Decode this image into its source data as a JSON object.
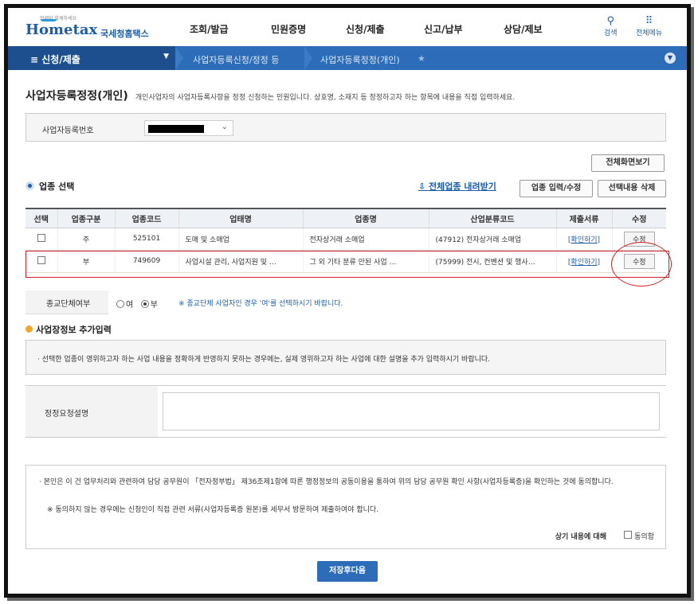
{
  "header": {
    "logo_tagline": "언제와 함께하세요",
    "logo_brand": "Hometax",
    "logo_kr": "국세청홈택스",
    "gnb": [
      "조회/발급",
      "민원증명",
      "신청/제출",
      "신고/납부",
      "상담/제보"
    ],
    "search_label": "검색",
    "all_menu_label": "전체메뉴"
  },
  "nav": {
    "menu_label": "≡  신청/제출",
    "breadcrumb": [
      "사업자등록신청/정정 등",
      "사업자등록정정(개인)"
    ]
  },
  "page": {
    "title": "사업자등록정정(개인)",
    "description": "개인사업자의 사업자등록사항을 정정 신청하는 민원입니다. 상호명, 소재지 등 정정하고자 하는 항목에 내용을 직접 입력하세요."
  },
  "biz": {
    "label": "사업자등록번호"
  },
  "buttons": {
    "full_view": "전체화면보기",
    "industry_edit": "업종 입력/수정",
    "delete_selected": "선택내용 삭제",
    "save_next": "저장후다음"
  },
  "industry": {
    "section_title": "업종 선택",
    "download_all": "전체업종 내려받기",
    "columns": [
      "선택",
      "업종구분",
      "업종코드",
      "업태명",
      "업종명",
      "산업분류코드",
      "제출서류",
      "수정"
    ],
    "rows": [
      {
        "type": "주",
        "code": "525101",
        "biz_type": "도매 및 소매업",
        "item": "전자상거래 소매업",
        "class_code": "(47912) 전자상거래 소매업",
        "doc": "[확인하기]",
        "edit": "수정"
      },
      {
        "type": "부",
        "code": "749609",
        "biz_type": "사업시설 관리, 사업지원 및 …",
        "item": "그 외 기타 분류 안된 사업 …",
        "class_code": "(75999) 전시, 컨벤션 및 행사…",
        "doc": "[확인하기]",
        "edit": "수정"
      }
    ]
  },
  "religion": {
    "label": "종교단체여부",
    "yes": "여",
    "no": "부",
    "selected": "부",
    "note": "※ 종교단체 사업자인 경우 '여'를 선택하시기 바랍니다."
  },
  "workplace": {
    "section_title": "사업장정보 추가입력",
    "info": "· 선택한 업종이 영위하고자 하는 사업 내용을 정확하게 반영하지 못하는 경우에는, 실제 영위하고자 하는 사업에 대한 설명을 추가 입력하시기 바랍니다.",
    "request_label": "정정요청설명"
  },
  "consent": {
    "p1": "· 본인은 이 건 업무처리와 관련하여 담당 공무원이 「전자정부법」 제36조제1항에 따른 행정정보의 공동이용을 통하여 위의 담당 공무원 확인 사항(사업자등록증)을 확인하는 것에 동의합니다.",
    "p2": "※  동의하지 않는 경우에는 신청인이 직접 관련 서류(사업자등록증 원본)를 세무서 방문하여 제출하여야 합니다.",
    "question": "상기 내용에 대해",
    "agree_label": "동의함"
  }
}
